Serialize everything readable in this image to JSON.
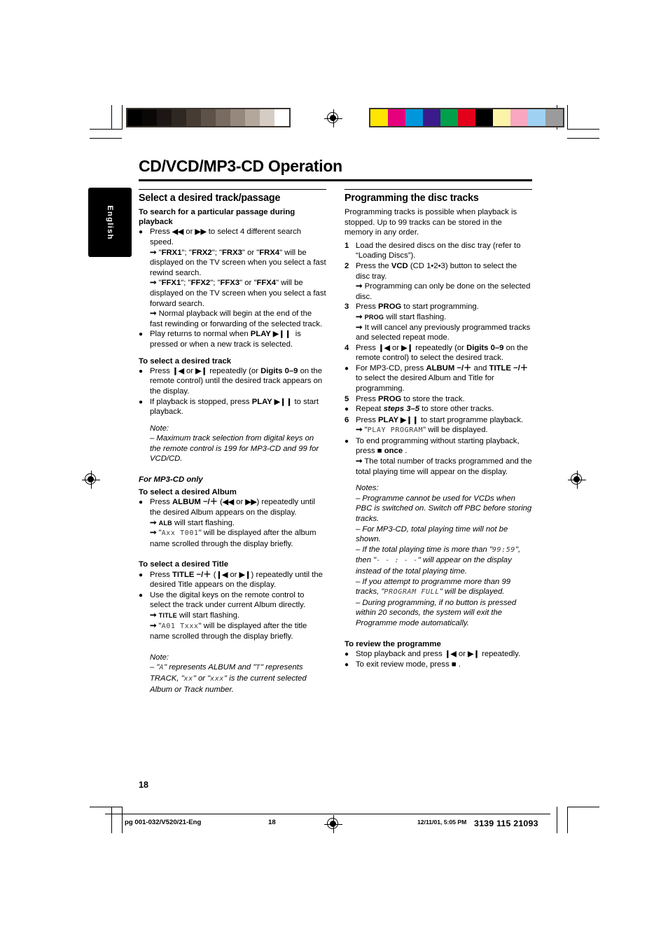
{
  "document": {
    "title": "CD/VCD/MP3-CD Operation",
    "page_number": "18",
    "language_tab": "English"
  },
  "calibration": {
    "gray_swatches": [
      "#000000",
      "#0a0806",
      "#1c1714",
      "#2e2722",
      "#463c34",
      "#5d5148",
      "#786b61",
      "#96887d",
      "#b3a79c",
      "#d5cdc4",
      "#ffffff"
    ],
    "color_swatches": [
      "#ffe500",
      "#e5007d",
      "#0096dc",
      "#3b1a8c",
      "#00a04b",
      "#e3001b",
      "#000000",
      "#fbf4a8",
      "#f8a7c0",
      "#9fd2f2",
      "#9b9b9b"
    ]
  },
  "left_column": {
    "heading": "Select a desired track/passage",
    "sub1": {
      "heading_line1": "To search for a particular passage during",
      "heading_line2": "playback",
      "bullets": [
        {
          "marker": "●",
          "text": "Press ◄◄ or ►► to select 4 different search speed.",
          "arrows": [
            "\"FRX1\"; \"FRX2\"; \"FRX3\" or \"FRX4\" will be displayed on the TV screen when you select a fast rewind search.",
            "\"FFX1\"; \"FFX2\"; \"FFX3\" or \"FFX4\" will be displayed on the TV screen when you select a fast forward search.",
            "Normal playback will begin at the end of the fast rewinding or forwarding of the selected track."
          ]
        },
        {
          "marker": "●",
          "text": "Play returns to normal when PLAY ►Ⅱ is pressed or when a new track is selected."
        }
      ]
    },
    "sub2": {
      "heading": "To select a desired track",
      "bullets": [
        "Press ▏◄ or ►▕ repeatedly (or Digits 0–9 on the remote control) until the desired track appears on the display.",
        "If playback is stopped, press PLAY ►Ⅱ to start playback."
      ],
      "note_label": "Note:",
      "note_text": "–  Maximum track selection from digital keys on the remote control is 199 for MP3-CD and 99 for VCD/CD."
    },
    "sub3": {
      "heading": "For MP3-CD only",
      "album_heading": "To select a desired Album",
      "album_bullet": "Press ALBUM −/＋ (◄◄ or ►►) repeatedly until the desired Album appears on the display.",
      "album_arrow1_prefix": "",
      "album_arrow1_caps": "ALB",
      "album_arrow1_rest": " will start flashing.",
      "album_arrow2_lcd": "Axx T001",
      "album_arrow2_rest": " will be displayed after the album name scrolled through the display briefly.",
      "title_heading": "To select a desired Title",
      "title_bullets": [
        "Press TITLE −/＋ (▏◄ or ►▕) repeatedly until the desired Title appears on the display.",
        "Use the digital keys on the remote control to select the track under current Album directly."
      ],
      "title_arrow1_caps": "TITLE",
      "title_arrow1_rest": " will start flashing.",
      "title_arrow2_lcd": "A01 Txxx",
      "title_arrow2_rest": " will be displayed after the title name scrolled through the display briefly."
    },
    "final_note": {
      "label": "Note:",
      "seg1": "–  \"",
      "lcd1": "A",
      "seg2": "\" represents ALBUM and \"",
      "lcd2": "T",
      "seg3": "\" represents TRACK, \"",
      "lcd3": "xx",
      "seg4": "\" or \"",
      "lcd4": "xxx",
      "seg5": "\" is the current selected Album or Track number."
    }
  },
  "right_column": {
    "heading": "Programming the disc tracks",
    "intro": "Programming tracks is possible when playback is stopped. Up to 99 tracks can be stored in the memory in any order.",
    "steps": [
      {
        "marker": "1",
        "text": "Load the desired discs on the disc tray (refer to “Loading Discs”).",
        "arrows": []
      },
      {
        "marker": "2",
        "text": "Press the VCD (CD 1•2•3) button to select the disc tray.",
        "arrows": [
          "Programming can only be done on the selected disc."
        ]
      },
      {
        "marker": "3",
        "text": "Press PROG to start programming.",
        "arrows": [
          "PROG will start flashing.",
          "It will cancel any previously programmed tracks and selected repeat mode."
        ]
      },
      {
        "marker": "4",
        "text": "Press ▏◄ or ►▕ repeatedly (or Digits 0–9 on the remote control) to select the desired track.",
        "arrows": []
      },
      {
        "marker": "●",
        "text": "For MP3-CD, press ALBUM −/＋ and TITLE −/＋ to select the desired Album and Title for programming.",
        "arrows": []
      },
      {
        "marker": "5",
        "text": "Press PROG to store the track.",
        "arrows": []
      },
      {
        "marker": "●",
        "text": "Repeat steps 3–5 to store other tracks.",
        "arrows": []
      },
      {
        "marker": "6",
        "text": "Press PLAY ►Ⅱ to start programme playback.",
        "arrows": [
          "\"PLAY PROGRAM\" will be displayed."
        ]
      },
      {
        "marker": "●",
        "text": "To end programming without starting playback, press ■ once .",
        "arrows": [
          "The total number of tracks programmed and the total playing time will appear on the display."
        ]
      }
    ],
    "notes_label": "Notes:",
    "notes": [
      "–  Programme cannot be used for VCDs when PBC is switched on. Switch off PBC before storing tracks.",
      "–  For MP3-CD, total playing time will not be shown.",
      "–  If the total playing time is more than \"99:59\", then \"- - : - -\" will appear on the display instead of the total playing time.",
      "–  If you attempt to programme more than 99 tracks, \"PROGRAM FULL\" will be displayed.",
      "–  During programming, if no button is pressed within 20 seconds, the system will exit the Programme mode automatically."
    ],
    "note_lcd": {
      "time_limit": "99:59",
      "dashes": "- - : - -",
      "program_full": "PROGRAM FULL"
    },
    "review_heading": "To review the programme",
    "review_bullets": [
      "Stop playback and press ▏◄ or ►▕ repeatedly.",
      "To exit review mode, press ■ ."
    ]
  },
  "footer": {
    "file_ref": "pg 001-032/V520/21-Eng",
    "page": "18",
    "timestamp": "12/11/01, 5:05 PM",
    "doc_code": "3139 115 21093"
  }
}
